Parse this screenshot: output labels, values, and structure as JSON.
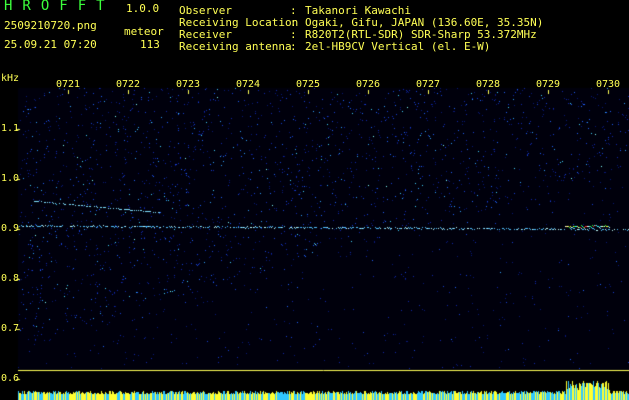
{
  "header": {
    "app_title": "HROFFT",
    "app_version": "1.0.0",
    "file_name": "2509210720.png",
    "timestamp": "25.09.21 07:20",
    "count_label": "meteor",
    "count_value": "113"
  },
  "station_info": [
    {
      "label": "Observer",
      "value": "Takanori Kawachi"
    },
    {
      "label": "Receiving Location",
      "value": "Ogaki, Gifu, JAPAN (136.60E, 35.35N)"
    },
    {
      "label": "Receiver",
      "value": "R820T2(RTL-SDR) SDR-Sharp 53.372MHz"
    },
    {
      "label": "Receiving antenna",
      "value": "2el-HB9CV Vertical (el. E-W)"
    }
  ],
  "spectrogram": {
    "freq_unit": "kHz",
    "time_ticks": [
      "0721",
      "0722",
      "0723",
      "0724",
      "0725",
      "0726",
      "0727",
      "0728",
      "0729",
      "0730"
    ],
    "freq_ticks": [
      "1.1",
      "1.0",
      "0.9",
      "0.8",
      "0.7",
      "0.6"
    ],
    "colors": {
      "background": "#000010",
      "noise": "#1030c8",
      "signal": "#30c8ff",
      "axis": "#ffff55",
      "baseline": "#ffff00"
    }
  }
}
